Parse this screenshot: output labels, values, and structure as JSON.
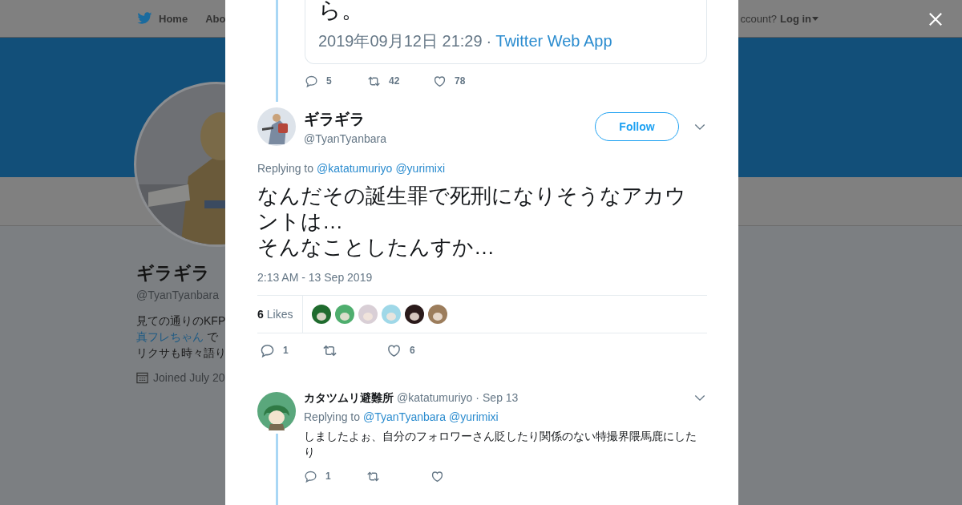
{
  "background_page": {
    "nav": {
      "home": "Home",
      "about": "Abo",
      "account_prompt": "ccount?",
      "login": "Log in"
    },
    "profile": {
      "name": "ギラギラ",
      "handle": "@TyanTyanbara",
      "bio": [
        {
          "text": "見ての通りのKFP"
        },
        {
          "link": "真フレちゃん",
          "text": "で"
        },
        {
          "text": "リクサも時々語り"
        }
      ],
      "joined": "Joined July 20"
    }
  },
  "quoted_tweet": {
    "text": "ら。",
    "timestamp": "2019年09月12日 21:29",
    "separator": "·",
    "source": "Twitter Web App"
  },
  "parent_actions": {
    "replies": "5",
    "retweets": "42",
    "likes": "78"
  },
  "tweet": {
    "name": "ギラギラ",
    "handle": "@TyanTyanbara",
    "follow": "Follow",
    "replying_label": "Replying to",
    "mentions": [
      "@katatumuriyo",
      "@yurimixi"
    ],
    "paragraphs": [
      "なんだその誕生罪で死刑になりそうなアカウントは…",
      "そんなことしたんすか…"
    ],
    "time": "2:13 AM - 13 Sep 2019",
    "like_count": "6",
    "like_label": "Likes",
    "likers": [
      {
        "color": "#1f6b2e"
      },
      {
        "color": "#4fae6e"
      },
      {
        "color": "#d9cfd6"
      },
      {
        "color": "#9fd8e8"
      },
      {
        "color": "#2a1a1a"
      },
      {
        "color": "#9c7d5c"
      }
    ],
    "actions": {
      "replies": "1",
      "likes": "6"
    }
  },
  "replies": [
    {
      "name": "カタツムリ避難所",
      "handle": "@katatumuriyo",
      "separator": "·",
      "time": "Sep 13",
      "replying_label": "Replying to",
      "mentions": [
        "@TyanTyanbara",
        "@yurimixi"
      ],
      "text": "しましたよぉ、自分のフォロワーさん貶したり関係のない特撮界隈馬鹿にしたり",
      "actions": {
        "replies": "1"
      }
    }
  ]
}
